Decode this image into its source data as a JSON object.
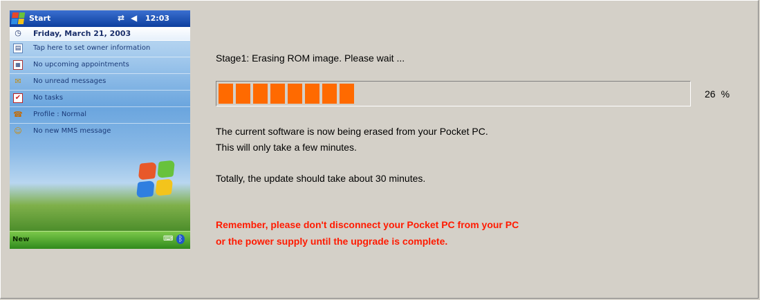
{
  "device": {
    "title": {
      "start_label": "Start",
      "time": "12:03",
      "icons": [
        "windows-flag-icon",
        "connectivity-icon",
        "volume-icon"
      ]
    },
    "today_items": [
      {
        "icon": "clock-icon",
        "label": "Friday, March 21, 2003"
      },
      {
        "icon": "owner-card-icon",
        "label": "Tap here to set owner information"
      },
      {
        "icon": "calendar-icon",
        "label": "No upcoming appointments"
      },
      {
        "icon": "envelope-icon",
        "label": "No unread messages"
      },
      {
        "icon": "tasks-checkbox-icon",
        "label": "No tasks"
      },
      {
        "icon": "phone-profile-icon",
        "label": "Profile : Normal"
      },
      {
        "icon": "mms-message-icon",
        "label": "No new MMS message"
      }
    ],
    "menubar": {
      "new_label": "New",
      "icons": [
        "input-panel-icon",
        "bluetooth-icon"
      ]
    }
  },
  "upgrade": {
    "stage_text": "Stage1: Erasing ROM image. Please wait  ...",
    "progress_percent": 26,
    "progress_value_text": "26",
    "progress_unit": "%",
    "info_line_1": "The current software is now being erased from your Pocket PC.",
    "info_line_2": "This will only take a few minutes.",
    "info_line_3": "Totally, the update should take about 30 minutes.",
    "warning_line_1": "Remember, please don't disconnect your Pocket PC from your PC",
    "warning_line_2": "or the power supply until the upgrade is complete."
  },
  "colors": {
    "progress_fill": "#ff6a00",
    "warning_text": "#ff1a00",
    "window_bg": "#d4d0c8"
  }
}
